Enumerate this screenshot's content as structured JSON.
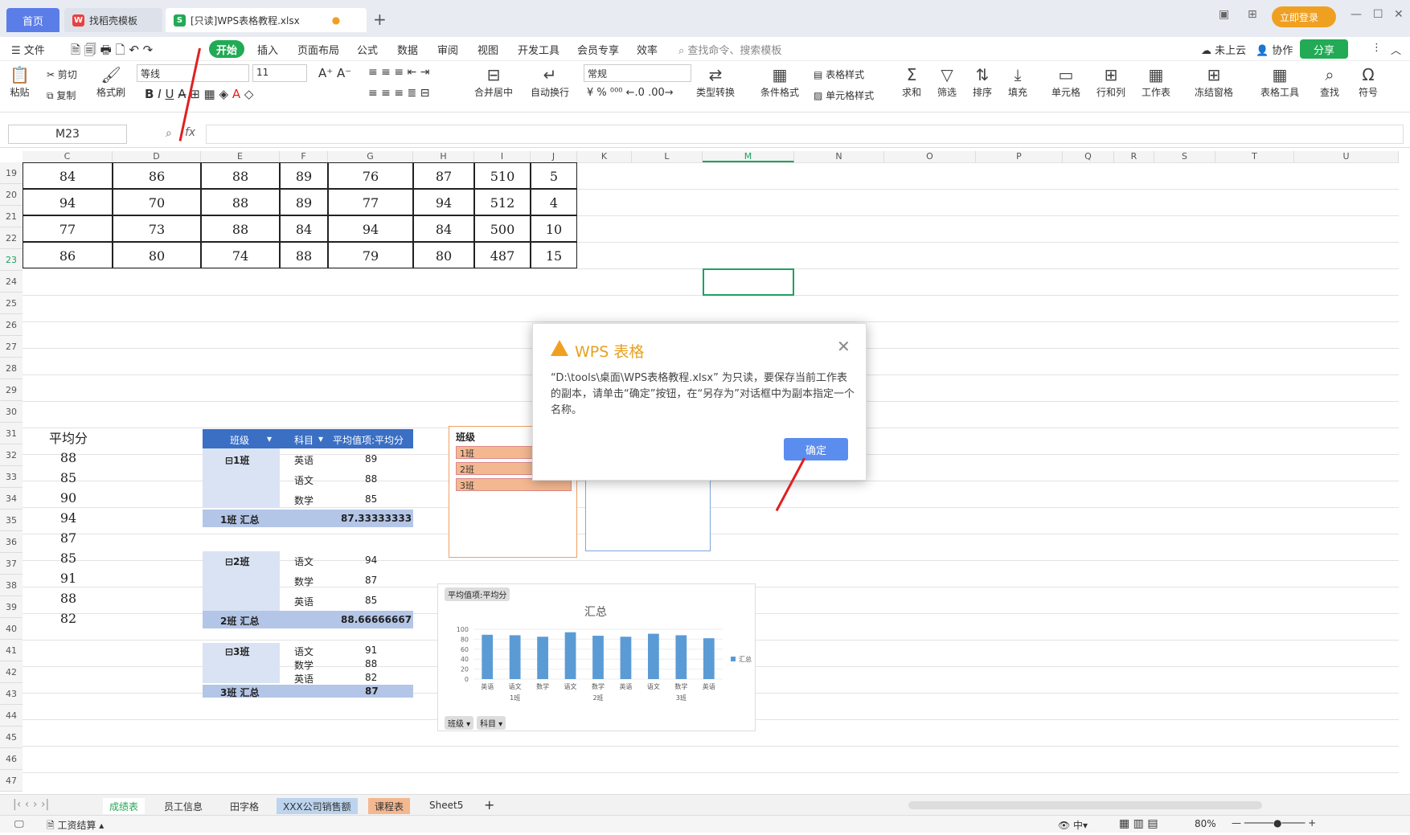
{
  "tabs": {
    "home": "首页",
    "t1": "找稻壳模板",
    "t2": "[只读]WPS表格教程.xlsx"
  },
  "login": "立即登录",
  "menu": {
    "file": "文件",
    "start": "开始",
    "items": [
      "插入",
      "页面布局",
      "公式",
      "数据",
      "审阅",
      "视图",
      "开发工具",
      "会员专享",
      "效率"
    ],
    "search": "查找命令、搜索模板",
    "cloud": "未上云",
    "collab": "协作",
    "share": "分享"
  },
  "toolbar": {
    "paste": "粘贴",
    "cut": "剪切",
    "copy": "复制",
    "format_painter": "格式刷",
    "font": "等线",
    "size": "11",
    "merge": "合并居中",
    "wrap": "自动换行",
    "numfmt": "常规",
    "convert": "类型转换",
    "cond": "条件格式",
    "table_style": "表格样式",
    "cell_style": "单元格样式",
    "sum": "求和",
    "filter": "筛选",
    "sort": "排序",
    "fill": "填充",
    "cell": "单元格",
    "rowcol": "行和列",
    "sheet": "工作表",
    "freeze": "冻结窗格",
    "tabletool": "表格工具",
    "find": "查找",
    "symbol": "符号"
  },
  "formula": {
    "namebox": "M23",
    "fx": "fx"
  },
  "cols": [
    "C",
    "D",
    "E",
    "F",
    "G",
    "H",
    "I",
    "J",
    "K",
    "L",
    "M",
    "N",
    "O",
    "P",
    "Q",
    "R",
    "S",
    "T",
    "U"
  ],
  "rows": [
    "19",
    "20",
    "21",
    "22",
    "23",
    "24",
    "25",
    "26",
    "27",
    "28",
    "29",
    "30",
    "31",
    "32",
    "33",
    "34",
    "35",
    "36",
    "37",
    "38",
    "39",
    "40",
    "41",
    "42",
    "43",
    "44",
    "45",
    "46",
    "47"
  ],
  "table": [
    [
      "84",
      "86",
      "88",
      "89",
      "76",
      "87",
      "510",
      "5"
    ],
    [
      "94",
      "70",
      "88",
      "89",
      "77",
      "94",
      "512",
      "4"
    ],
    [
      "77",
      "73",
      "88",
      "84",
      "94",
      "84",
      "500",
      "10"
    ],
    [
      "86",
      "80",
      "74",
      "88",
      "79",
      "80",
      "487",
      "15"
    ]
  ],
  "avg": {
    "label": "平均分",
    "values": [
      "88",
      "85",
      "90",
      "94",
      "87",
      "85",
      "91",
      "88",
      "82"
    ]
  },
  "pivot": {
    "h1": "班级",
    "h2": "科目",
    "h3": "平均值项:平均分",
    "c1": "⊟1班",
    "c2": "⊟2班",
    "c3": "⊟3班",
    "r1": [
      [
        "英语",
        "89"
      ],
      [
        "语文",
        "88"
      ],
      [
        "数学",
        "85"
      ]
    ],
    "t1": [
      "1班 汇总",
      "87.33333333"
    ],
    "r2": [
      [
        "语文",
        "94"
      ],
      [
        "数学",
        "87"
      ],
      [
        "英语",
        "85"
      ]
    ],
    "t2": [
      "2班 汇总",
      "88.66666667"
    ],
    "r3": [
      [
        "语文",
        "91"
      ],
      [
        "数学",
        "88"
      ],
      [
        "英语",
        "82"
      ]
    ],
    "t3": [
      "3班 汇总",
      "87"
    ]
  },
  "slicer": {
    "title": "班级",
    "items": [
      "1班",
      "2班",
      "3班"
    ]
  },
  "chart": {
    "btn": "平均值项:平均分",
    "legend": "汇总",
    "btn2": "班级",
    "btn3": "科目"
  },
  "chart_data": {
    "type": "bar",
    "title": "汇总",
    "categories": [
      "英语",
      "语文",
      "数学",
      "语文",
      "数学",
      "英语",
      "语文",
      "数学",
      "英语"
    ],
    "groups": [
      "1班",
      "2班",
      "3班"
    ],
    "series": [
      {
        "name": "汇总",
        "values": [
          89,
          88,
          85,
          94,
          87,
          85,
          91,
          88,
          82
        ]
      }
    ],
    "ylim": [
      0,
      100
    ],
    "yticks": [
      "100",
      "80",
      "60",
      "40",
      "20",
      "0"
    ]
  },
  "dialog": {
    "title": "WPS 表格",
    "message": "“D:\\tools\\桌面\\WPS表格教程.xlsx” 为只读，要保存当前工作表的副本，请单击“确定”按钮，在“另存为”对话框中为副本指定一个名称。",
    "ok": "确定"
  },
  "sheets": [
    "成绩表",
    "员工信息",
    "田字格",
    "XXX公司销售额",
    "课程表",
    "Sheet5"
  ],
  "status": {
    "left": "工资结算",
    "zoom": "80%"
  }
}
